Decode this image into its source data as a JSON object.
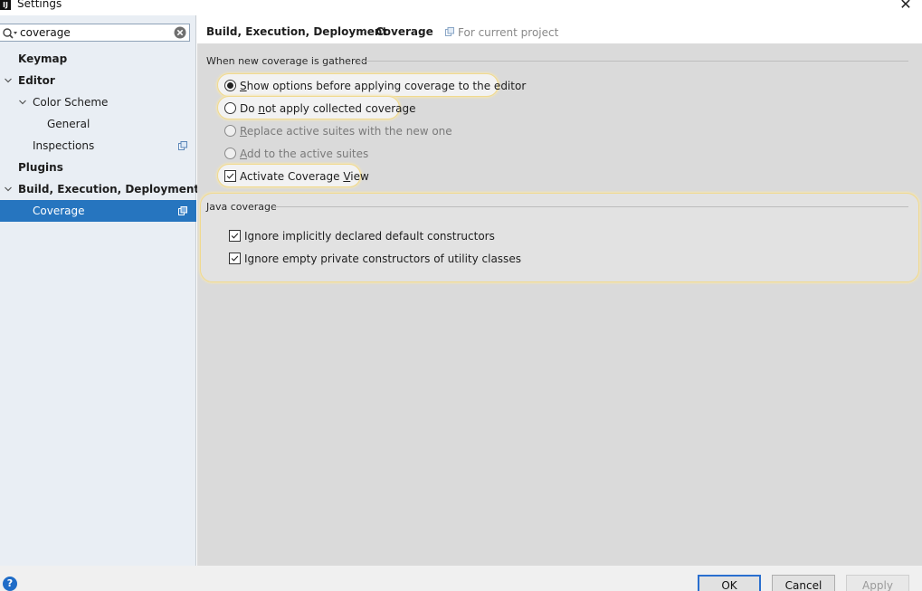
{
  "window": {
    "title": "Settings",
    "icon": "intellij-icon",
    "close_glyph": "✕"
  },
  "search": {
    "value": "coverage",
    "placeholder": ""
  },
  "sidebar": {
    "items": [
      {
        "label": "Keymap"
      },
      {
        "label": "Editor"
      },
      {
        "label": "Color Scheme"
      },
      {
        "label": "General"
      },
      {
        "label": "Inspections"
      },
      {
        "label": "Plugins"
      },
      {
        "label": "Build, Execution, Deployment"
      },
      {
        "label": "Coverage"
      }
    ]
  },
  "header": {
    "breadcrumb": [
      "Build, Execution, Deployment",
      "Coverage"
    ],
    "separator": "›",
    "scope": "For current project"
  },
  "main": {
    "coverage_group": {
      "title": "When new coverage is gathered",
      "options": [
        {
          "before": "",
          "u": "S",
          "after": "how options before applying coverage to the editor",
          "checked": true,
          "enabled": true
        },
        {
          "before": "Do ",
          "u": "n",
          "after": "ot apply collected coverage",
          "checked": false,
          "enabled": true
        },
        {
          "before": "",
          "u": "R",
          "after": "eplace active suites with the new one",
          "checked": false,
          "enabled": false
        },
        {
          "before": "",
          "u": "A",
          "after": "dd to the active suites",
          "checked": false,
          "enabled": false
        }
      ],
      "activate_view": {
        "before": "Activate Coverage ",
        "u": "V",
        "after": "iew",
        "checked": true
      }
    },
    "java_group": {
      "title": "Java coverage",
      "options": [
        {
          "label": "Ignore implicitly declared default constructors",
          "checked": true
        },
        {
          "label": "Ignore empty private constructors of utility classes",
          "checked": true
        }
      ]
    }
  },
  "footer": {
    "help": "?",
    "ok": "OK",
    "cancel": "Cancel",
    "apply": "Apply"
  },
  "colors": {
    "selection": "#2675bf",
    "highlight_border": "#f0d98f",
    "content_bg": "#dadada"
  }
}
